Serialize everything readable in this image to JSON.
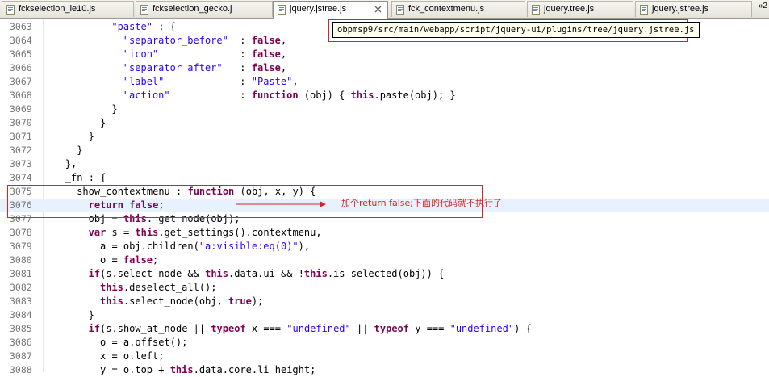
{
  "tabs": [
    {
      "label": "fckselection_ie10.js",
      "active": false,
      "icon": "js-file-icon"
    },
    {
      "label": "fckselection_gecko.j",
      "active": false,
      "icon": "js-file-icon"
    },
    {
      "label": "jquery.jstree.js",
      "active": true,
      "icon": "js-file-icon"
    },
    {
      "label": "fck_contextmenu.js",
      "active": false,
      "icon": "js-file-icon"
    },
    {
      "label": "jquery.tree.js",
      "active": false,
      "icon": "js-file-icon"
    },
    {
      "label": "jquery.jstree.js",
      "active": false,
      "icon": "js-file-icon"
    }
  ],
  "tab_overflow": "»2",
  "file_path_tooltip": "obpmsp9/src/main/webapp/script/jquery-ui/plugins/tree/jquery.jstree.js",
  "annotation_note": "加个return false;下面的代码就不执行了",
  "colors": {
    "keyword": "#7f0055",
    "string": "#2a00ff",
    "annotation": "#e02020",
    "current_line": "#e8f2fe",
    "line_number": "#787878"
  },
  "code_lines": [
    {
      "num": "3063",
      "indent": 12,
      "tokens": [
        {
          "t": "s",
          "v": "\"paste\""
        },
        {
          "t": "p",
          "v": " : {"
        }
      ]
    },
    {
      "num": "3064",
      "indent": 14,
      "tokens": [
        {
          "t": "s",
          "v": "\"separator_before\""
        },
        {
          "t": "p",
          "v": "  : "
        },
        {
          "t": "k",
          "v": "false"
        },
        {
          "t": "p",
          "v": ","
        }
      ]
    },
    {
      "num": "3065",
      "indent": 14,
      "tokens": [
        {
          "t": "s",
          "v": "\"icon\""
        },
        {
          "t": "p",
          "v": "              : "
        },
        {
          "t": "k",
          "v": "false"
        },
        {
          "t": "p",
          "v": ","
        }
      ]
    },
    {
      "num": "3066",
      "indent": 14,
      "tokens": [
        {
          "t": "s",
          "v": "\"separator_after\""
        },
        {
          "t": "p",
          "v": "   : "
        },
        {
          "t": "k",
          "v": "false"
        },
        {
          "t": "p",
          "v": ","
        }
      ]
    },
    {
      "num": "3067",
      "indent": 14,
      "tokens": [
        {
          "t": "s",
          "v": "\"label\""
        },
        {
          "t": "p",
          "v": "             : "
        },
        {
          "t": "s",
          "v": "\"Paste\""
        },
        {
          "t": "p",
          "v": ","
        }
      ]
    },
    {
      "num": "3068",
      "indent": 14,
      "tokens": [
        {
          "t": "s",
          "v": "\"action\""
        },
        {
          "t": "p",
          "v": "            : "
        },
        {
          "t": "k",
          "v": "function"
        },
        {
          "t": "p",
          "v": " (obj) { "
        },
        {
          "t": "k",
          "v": "this"
        },
        {
          "t": "p",
          "v": ".paste(obj); }"
        }
      ]
    },
    {
      "num": "3069",
      "indent": 12,
      "tokens": [
        {
          "t": "p",
          "v": "}"
        }
      ]
    },
    {
      "num": "3070",
      "indent": 10,
      "tokens": [
        {
          "t": "p",
          "v": "}"
        }
      ]
    },
    {
      "num": "3071",
      "indent": 8,
      "tokens": [
        {
          "t": "p",
          "v": "}"
        }
      ]
    },
    {
      "num": "3072",
      "indent": 6,
      "tokens": [
        {
          "t": "p",
          "v": "}"
        }
      ]
    },
    {
      "num": "3073",
      "indent": 4,
      "tokens": [
        {
          "t": "p",
          "v": "},"
        }
      ]
    },
    {
      "num": "3074",
      "indent": 4,
      "tokens": [
        {
          "t": "p",
          "v": "_fn : {"
        }
      ]
    },
    {
      "num": "3075",
      "indent": 6,
      "tokens": [
        {
          "t": "p",
          "v": "show_contextmenu : "
        },
        {
          "t": "k",
          "v": "function"
        },
        {
          "t": "p",
          "v": " (obj, x, y) {"
        }
      ]
    },
    {
      "num": "3076",
      "indent": 8,
      "highlight": true,
      "cursor": true,
      "tokens": [
        {
          "t": "k",
          "v": "return"
        },
        {
          "t": "p",
          "v": " "
        },
        {
          "t": "k",
          "v": "false"
        },
        {
          "t": "p",
          "v": ";"
        }
      ]
    },
    {
      "num": "3077",
      "indent": 8,
      "tokens": [
        {
          "t": "p",
          "v": "obj = "
        },
        {
          "t": "k",
          "v": "this"
        },
        {
          "t": "p",
          "v": "._get_node(obj);"
        }
      ]
    },
    {
      "num": "3078",
      "indent": 8,
      "tokens": [
        {
          "t": "k",
          "v": "var"
        },
        {
          "t": "p",
          "v": " s = "
        },
        {
          "t": "k",
          "v": "this"
        },
        {
          "t": "p",
          "v": ".get_settings().contextmenu,"
        }
      ]
    },
    {
      "num": "3079",
      "indent": 10,
      "tokens": [
        {
          "t": "p",
          "v": "a = obj.children("
        },
        {
          "t": "s",
          "v": "\"a:visible:eq(0)\""
        },
        {
          "t": "p",
          "v": "),"
        }
      ]
    },
    {
      "num": "3080",
      "indent": 10,
      "tokens": [
        {
          "t": "p",
          "v": "o = "
        },
        {
          "t": "k",
          "v": "false"
        },
        {
          "t": "p",
          "v": ";"
        }
      ]
    },
    {
      "num": "3081",
      "indent": 8,
      "tokens": [
        {
          "t": "k",
          "v": "if"
        },
        {
          "t": "p",
          "v": "(s.select_node && "
        },
        {
          "t": "k",
          "v": "this"
        },
        {
          "t": "p",
          "v": ".data.ui && !"
        },
        {
          "t": "k",
          "v": "this"
        },
        {
          "t": "p",
          "v": ".is_selected(obj)) {"
        }
      ]
    },
    {
      "num": "3082",
      "indent": 10,
      "tokens": [
        {
          "t": "k",
          "v": "this"
        },
        {
          "t": "p",
          "v": ".deselect_all();"
        }
      ]
    },
    {
      "num": "3083",
      "indent": 10,
      "tokens": [
        {
          "t": "k",
          "v": "this"
        },
        {
          "t": "p",
          "v": ".select_node(obj, "
        },
        {
          "t": "k",
          "v": "true"
        },
        {
          "t": "p",
          "v": ");"
        }
      ]
    },
    {
      "num": "3084",
      "indent": 8,
      "tokens": [
        {
          "t": "p",
          "v": "}"
        }
      ]
    },
    {
      "num": "3085",
      "indent": 8,
      "tokens": [
        {
          "t": "k",
          "v": "if"
        },
        {
          "t": "p",
          "v": "(s.show_at_node || "
        },
        {
          "t": "k",
          "v": "typeof"
        },
        {
          "t": "p",
          "v": " x === "
        },
        {
          "t": "s",
          "v": "\"undefined\""
        },
        {
          "t": "p",
          "v": " || "
        },
        {
          "t": "k",
          "v": "typeof"
        },
        {
          "t": "p",
          "v": " y === "
        },
        {
          "t": "s",
          "v": "\"undefined\""
        },
        {
          "t": "p",
          "v": ") {"
        }
      ]
    },
    {
      "num": "3086",
      "indent": 10,
      "tokens": [
        {
          "t": "p",
          "v": "o = a.offset();"
        }
      ]
    },
    {
      "num": "3087",
      "indent": 10,
      "tokens": [
        {
          "t": "p",
          "v": "x = o.left;"
        }
      ]
    },
    {
      "num": "3088",
      "indent": 10,
      "tokens": [
        {
          "t": "p",
          "v": "y = o.top + "
        },
        {
          "t": "k",
          "v": "this"
        },
        {
          "t": "p",
          "v": ".data.core.li_height;"
        }
      ]
    }
  ]
}
